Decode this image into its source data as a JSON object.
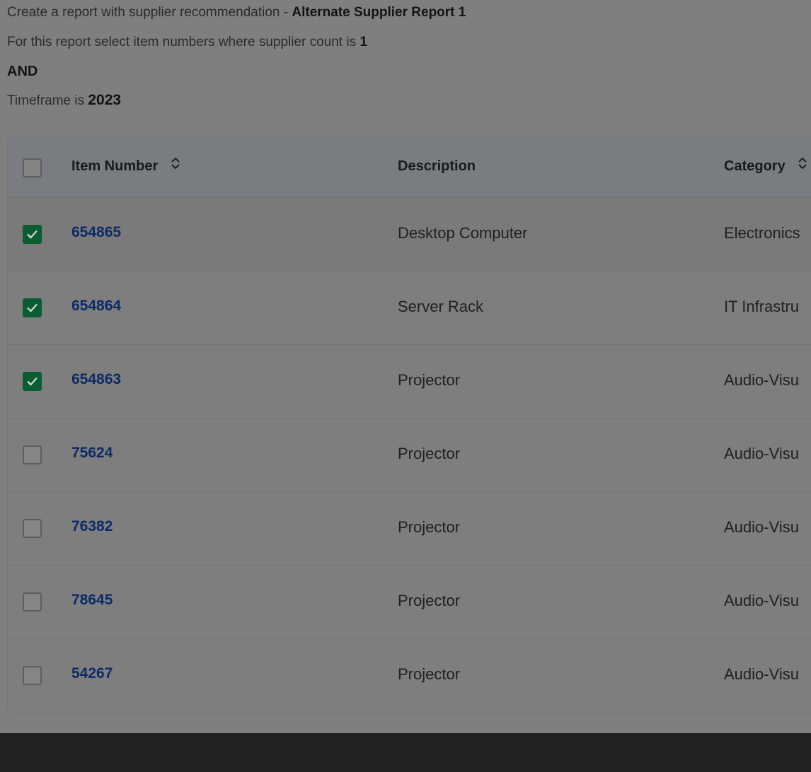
{
  "header": {
    "line1_prefix": "Create a report with supplier recommendation - ",
    "line1_report": "Alternate Supplier Report 1",
    "line2_prefix": "For this report select item numbers where supplier count is ",
    "line2_count": "1",
    "operator": "AND",
    "line4_prefix": "Timeframe is ",
    "line4_year": "2023"
  },
  "table": {
    "columns": {
      "item_number": "Item Number",
      "description": "Description",
      "category": "Category"
    },
    "rows": [
      {
        "checked": true,
        "item": "654865",
        "description": "Desktop Computer",
        "category": "Electronics"
      },
      {
        "checked": true,
        "item": "654864",
        "description": "Server Rack",
        "category": "IT Infrastru"
      },
      {
        "checked": true,
        "item": "654863",
        "description": "Projector",
        "category": "Audio-Visu"
      },
      {
        "checked": false,
        "item": "75624",
        "description": "Projector",
        "category": "Audio-Visu"
      },
      {
        "checked": false,
        "item": "76382",
        "description": "Projector",
        "category": "Audio-Visu"
      },
      {
        "checked": false,
        "item": "78645",
        "description": "Projector",
        "category": "Audio-Visu"
      },
      {
        "checked": false,
        "item": "54267",
        "description": "Projector",
        "category": "Audio-Visu"
      }
    ]
  },
  "colors": {
    "checkbox_checked": "#0a5c33",
    "item_link": "#0d2a66"
  },
  "icons": {
    "sort": "sort-icon",
    "check": "check-icon"
  }
}
